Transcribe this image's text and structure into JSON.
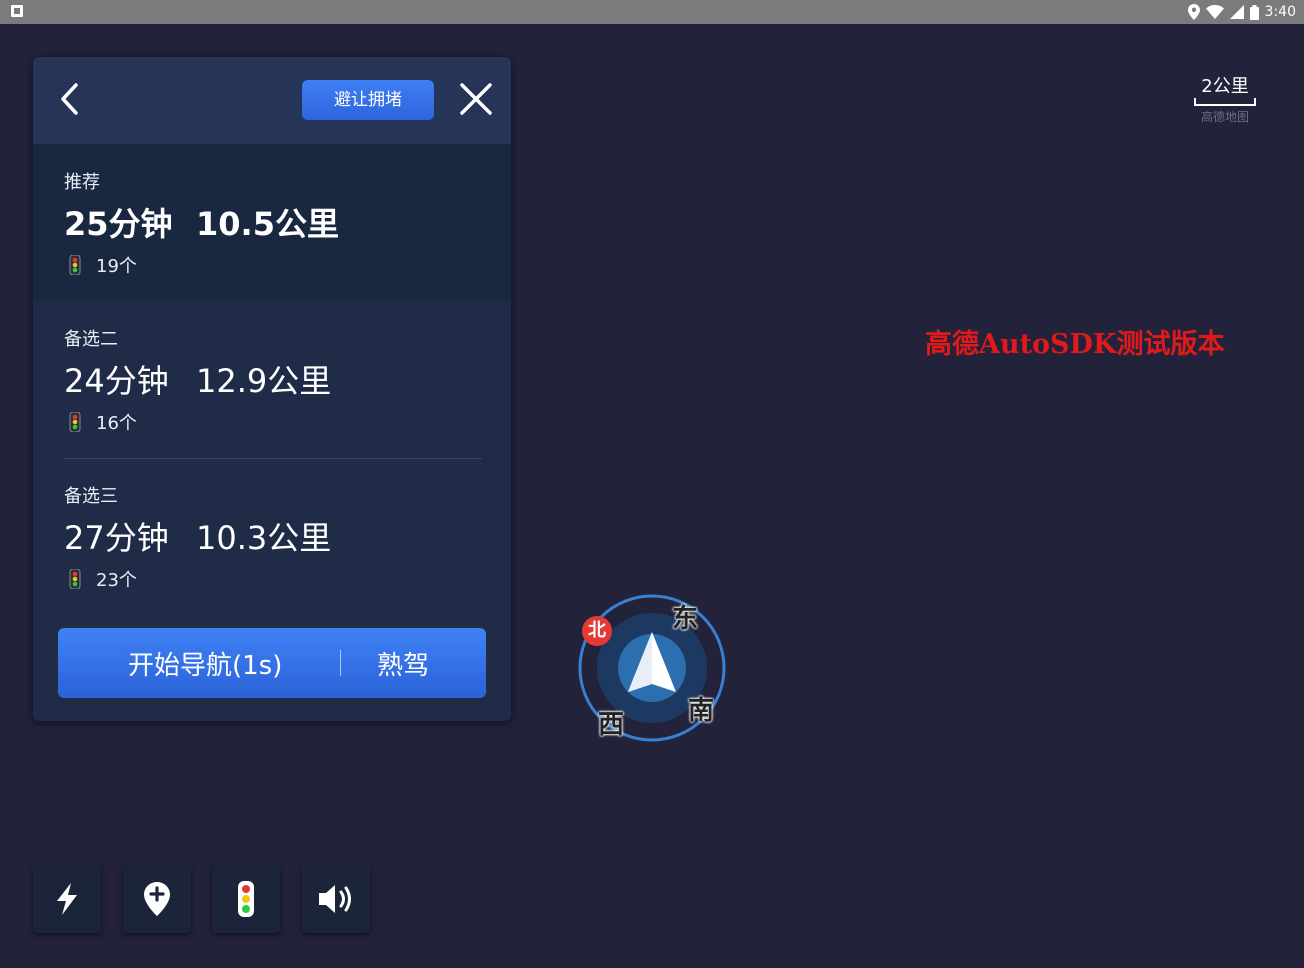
{
  "status_bar": {
    "time": "3:40"
  },
  "route_panel": {
    "avoid_congestion_label": "避让拥堵",
    "routes": [
      {
        "tag": "推荐",
        "time": "25分钟",
        "distance": "10.5公里",
        "traffic_lights": "19个",
        "selected": true
      },
      {
        "tag": "备选二",
        "time": "24分钟",
        "distance": "12.9公里",
        "traffic_lights": "16个",
        "selected": false
      },
      {
        "tag": "备选三",
        "time": "27分钟",
        "distance": "10.3公里",
        "traffic_lights": "23个",
        "selected": false
      }
    ],
    "start_navigation_label": "开始导航(1s)",
    "familiar_route_label": "熟驾"
  },
  "map": {
    "scale_value": "2公里",
    "scale_caption": "高德地图",
    "watermark": "高德AutoSDK测试版本",
    "compass": {
      "north": "北",
      "east": "东",
      "south": "南",
      "west": "西"
    }
  },
  "toolbar": {
    "items": [
      "lightning-icon",
      "add-location-icon",
      "traffic-light-icon",
      "volume-icon"
    ]
  },
  "colors": {
    "background": "#22223a",
    "panel": "#1f2b47",
    "accent_blue": "#3a78ee",
    "watermark_red": "#e01a1a",
    "north_badge": "#e53935"
  }
}
